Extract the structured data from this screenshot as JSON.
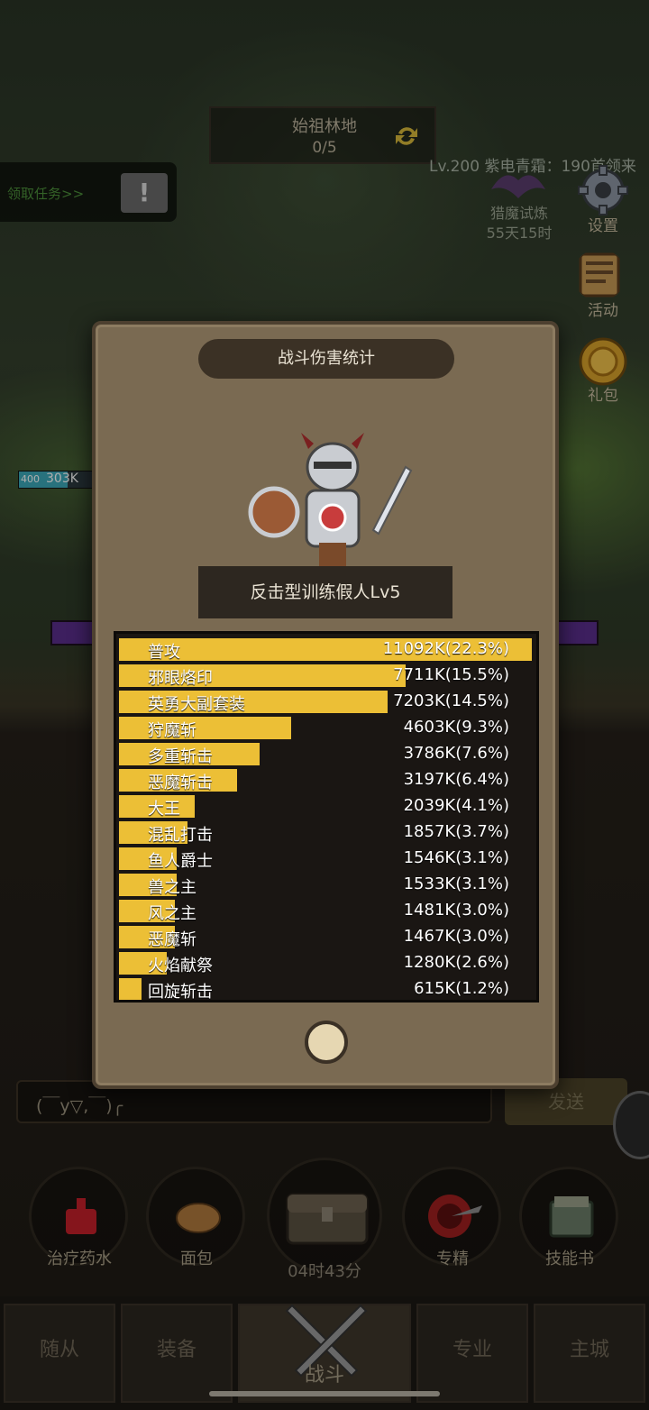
{
  "top": {
    "map_name": "始祖林地",
    "map_progress": "0/5",
    "level_announcement": "Lv.200 紫电青霜：190首领来",
    "quest_link": "领取任务>>",
    "quest_alert": "!",
    "hunt_trial": "猎魔试炼",
    "hunt_timer": "55天15时"
  },
  "side_menu": [
    {
      "label": "设置",
      "icon": "gear-icon"
    },
    {
      "label": "活动",
      "icon": "scroll-icon"
    },
    {
      "label": "礼包",
      "icon": "gift-coin-icon"
    }
  ],
  "player_hp": {
    "level": "400",
    "value": "303K"
  },
  "dialog": {
    "title": "战斗伤害统计",
    "target_name": "反击型训练假人Lv5",
    "stats": [
      {
        "name": "普攻",
        "value": "11092K(22.3%)",
        "share": 22.3
      },
      {
        "name": "邪眼烙印",
        "value": "7711K(15.5%)",
        "share": 15.5
      },
      {
        "name": "英勇大副套装",
        "value": "7203K(14.5%)",
        "share": 14.5
      },
      {
        "name": "狩魔斩",
        "value": "4603K(9.3%)",
        "share": 9.3
      },
      {
        "name": "多重斩击",
        "value": "3786K(7.6%)",
        "share": 7.6
      },
      {
        "name": "恶魔斩击",
        "value": "3197K(6.4%)",
        "share": 6.4
      },
      {
        "name": "大王",
        "value": "2039K(4.1%)",
        "share": 4.1
      },
      {
        "name": "混乱打击",
        "value": "1857K(3.7%)",
        "share": 3.7
      },
      {
        "name": "鱼人爵士",
        "value": "1546K(3.1%)",
        "share": 3.1
      },
      {
        "name": "兽之主",
        "value": "1533K(3.1%)",
        "share": 3.1
      },
      {
        "name": "风之主",
        "value": "1481K(3.0%)",
        "share": 3.0
      },
      {
        "name": "恶魔斩",
        "value": "1467K(3.0%)",
        "share": 3.0
      },
      {
        "name": "火焰献祭",
        "value": "1280K(2.6%)",
        "share": 2.6
      },
      {
        "name": "回旋斩击",
        "value": "615K(1.2%)",
        "share": 1.2
      }
    ]
  },
  "chat": {
    "input_text": "(￣y▽,￣)╭",
    "send_label": "发送"
  },
  "items": [
    {
      "label": "治疗药水",
      "icon": "potion-icon"
    },
    {
      "label": "面包",
      "icon": "bread-icon"
    },
    {
      "label": "",
      "icon": "treasure-chest-icon"
    },
    {
      "label": "专精",
      "icon": "target-sword-icon"
    },
    {
      "label": "技能书",
      "icon": "skill-book-icon"
    }
  ],
  "chest_timer": "04时43分",
  "nav": [
    {
      "label": "随从"
    },
    {
      "label": "装备"
    },
    {
      "label": "战斗"
    },
    {
      "label": "专业"
    },
    {
      "label": "主城"
    }
  ],
  "colors": {
    "bar_fill": "#ecbf36",
    "dialog_bg": "#7a6a52",
    "panel_bg": "#1a1613"
  }
}
